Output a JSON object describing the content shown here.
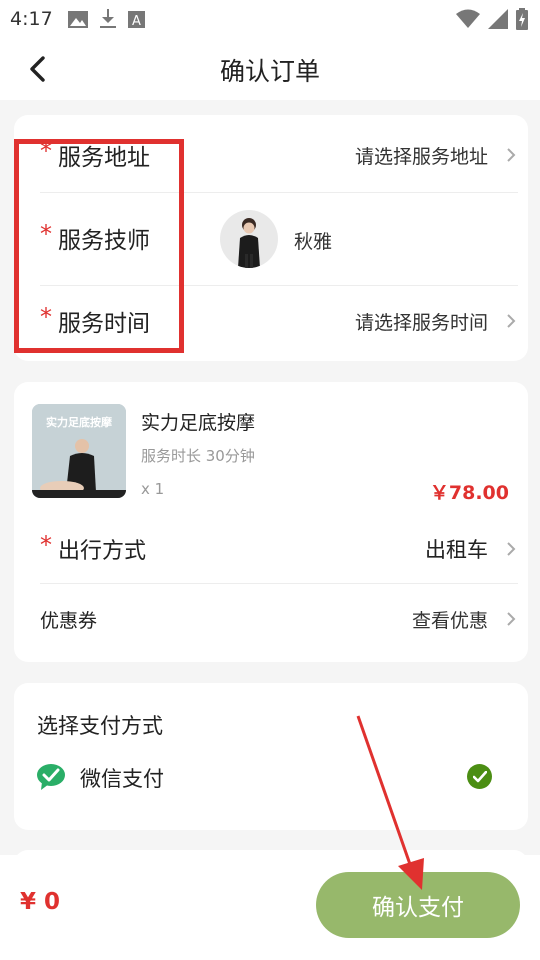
{
  "status_bar": {
    "time": "4:17",
    "left_icons": [
      "image-icon",
      "download-icon",
      "font-icon"
    ],
    "right_icons": [
      "wifi-icon",
      "signal-icon",
      "battery-icon"
    ]
  },
  "nav": {
    "title": "确认订单",
    "back_icon": "chevron-left-icon"
  },
  "service_card": {
    "address": {
      "required_mark": "*",
      "label": "服务地址",
      "value": "请选择服务地址"
    },
    "technician": {
      "required_mark": "*",
      "label": "服务技师",
      "name": "秋雅"
    },
    "time": {
      "required_mark": "*",
      "label": "服务时间",
      "value": "请选择服务时间"
    }
  },
  "order_card": {
    "thumb_text": "实力足底按摩",
    "name": "实力足底按摩",
    "duration": "服务时长 30分钟",
    "quantity": "x 1",
    "price": "￥78.00",
    "travel": {
      "required_mark": "*",
      "label": "出行方式",
      "value": "出租车"
    },
    "coupon": {
      "label": "优惠券",
      "value": "查看优惠"
    }
  },
  "payment": {
    "title": "选择支付方式",
    "method": "微信支付",
    "icon": "wechat-pay-icon",
    "selected": true
  },
  "bottom": {
    "total": "¥ 0",
    "confirm_label": "确认支付"
  },
  "colors": {
    "accent_red": "#e0312f",
    "button_green": "#97b86b",
    "check_green": "#4b8e13",
    "wechat_green": "#2aae67"
  }
}
